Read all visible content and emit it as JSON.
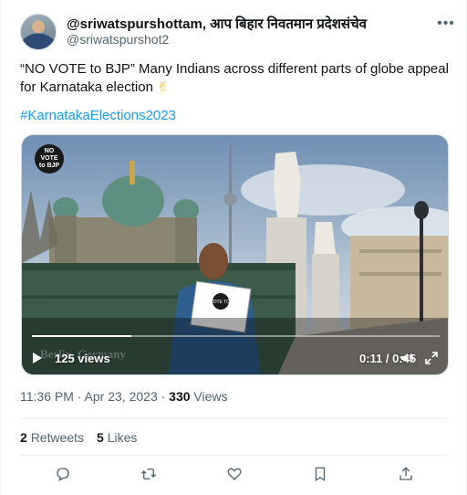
{
  "tweet": {
    "author": {
      "display_name": "@sriwatspurshottam, आप बिहार निवतमान प्रदेशसंचेव",
      "handle": "@sriwatspurshot2"
    },
    "more_icon": "more-dots-icon",
    "text": "“NO VOTE to BJP” Many Indians across different parts of globe appeal for Karnataka election",
    "emoji": "✌",
    "hashtag": "#KarnatakaElections2023",
    "video": {
      "badge_lines": [
        "NO",
        "VOTE",
        "to BJP"
      ],
      "sign_text": "NO VOTE TO BJP",
      "watermark": "Berlin, Germany",
      "views_label": "125 views",
      "time_label": "0:11 / 0:45",
      "progress_fraction": 0.244,
      "play_icon": "play-icon",
      "volume_icon": "volume-icon",
      "fullscreen_icon": "fullscreen-icon"
    },
    "timestamp": "11:36 PM · Apr 23, 2023 · ",
    "views_count": "330",
    "views_word": "Views",
    "retweets": {
      "count": "2",
      "label": "Retweets"
    },
    "likes": {
      "count": "5",
      "label": "Likes"
    },
    "actions": [
      "reply-icon",
      "retweet-icon",
      "like-icon",
      "bookmark-icon",
      "share-icon"
    ]
  },
  "colors": {
    "text": "#0f1419",
    "muted": "#536471",
    "link": "#1d9bf0",
    "border": "#eff3f4"
  }
}
